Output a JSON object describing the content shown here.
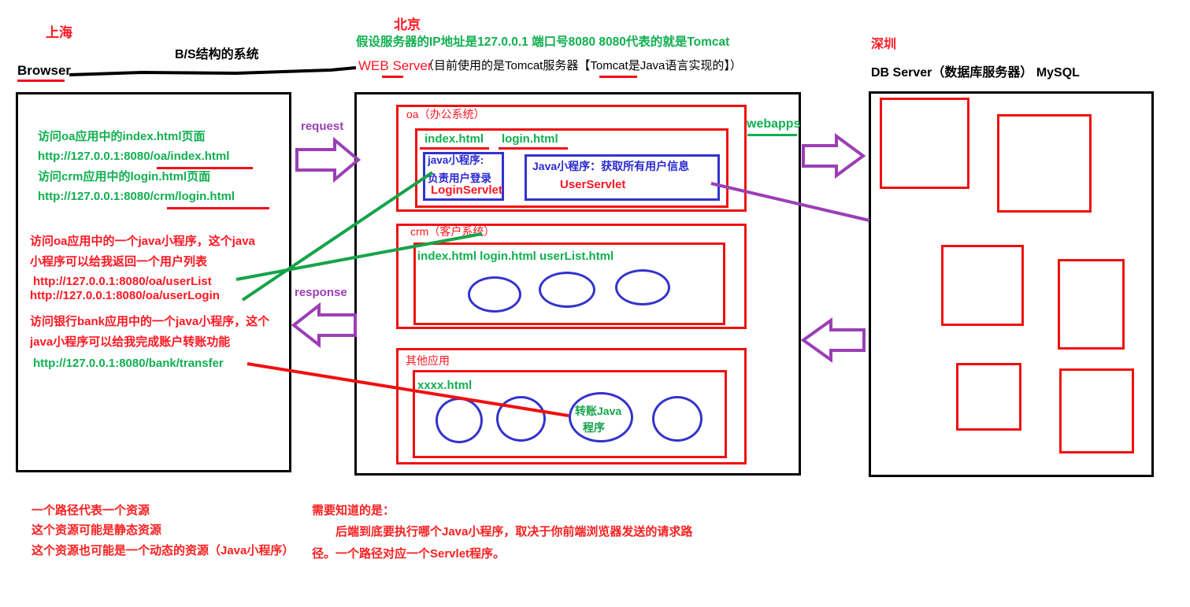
{
  "diagram": {
    "title_bs": "B/S结构的系统",
    "labels": {
      "shanghai": "上海",
      "beijing": "北京",
      "shenzhen": "深圳",
      "browser": "Browser",
      "web_server": "WEB Server",
      "web_server_note": "（目前使用的是Tomcat服务器【Tomcat是Java语言实现的】）",
      "server_ip_note": "假设服务器的IP地址是127.0.0.1 端口号8080    8080代表的就是Tomcat",
      "db_server": "DB Server（数据库服务器） MySQL",
      "webapps": "webapps",
      "request": "request",
      "response": "response"
    },
    "browser_notes": {
      "green_lines": [
        "访问oa应用中的index.html页面",
        "http://127.0.0.1:8080/oa/index.html",
        "访问crm应用中的login.html页面",
        "http://127.0.0.1:8080/crm/login.html"
      ],
      "red_block_1": [
        "访问oa应用中的一个java小程序，这个java",
        "小程序可以给我返回一个用户列表"
      ],
      "red_urls_1": [
        "http://127.0.0.1:8080/oa/userList",
        "http://127.0.0.1:8080/oa/userLogin"
      ],
      "red_block_2": [
        "访问银行bank应用中的一个java小程序，这个",
        "java小程序可以给我完成账户转账功能"
      ],
      "green_url_2": "http://127.0.0.1:8080/bank/transfer"
    },
    "apps": {
      "oa": {
        "title": "oa（办公系统）",
        "files": [
          "index.html",
          "login.html"
        ],
        "servlets": [
          {
            "desc1": "java小程序:",
            "desc2": "负责用户登录",
            "name": "LoginServlet"
          },
          {
            "desc1": "Java小程序：获取所有用户信息",
            "name": "UserServlet"
          }
        ]
      },
      "crm": {
        "title": "crm（客户系统）",
        "files_line": "index.html  login.html userList.html"
      },
      "other": {
        "title": "其他应用",
        "files_line": "xxxx.html",
        "circle_label_1": "转账Java",
        "circle_label_2": "程序"
      }
    },
    "footer_left": [
      "一个路径代表一个资源",
      "这个资源可能是静态资源",
      "这个资源也可能是一个动态的资源（Java小程序）"
    ],
    "footer_right": [
      "需要知道的是：",
      "　　后端到底要执行哪个Java小程序，取决于你前端浏览器发送的请求路",
      "径。一个路径对应一个Servlet程序。"
    ],
    "colors": {
      "red": "#ff1722",
      "green": "#10b050",
      "blue": "#2a2ad0",
      "purple": "#9b3fb5",
      "black": "#000000"
    }
  }
}
